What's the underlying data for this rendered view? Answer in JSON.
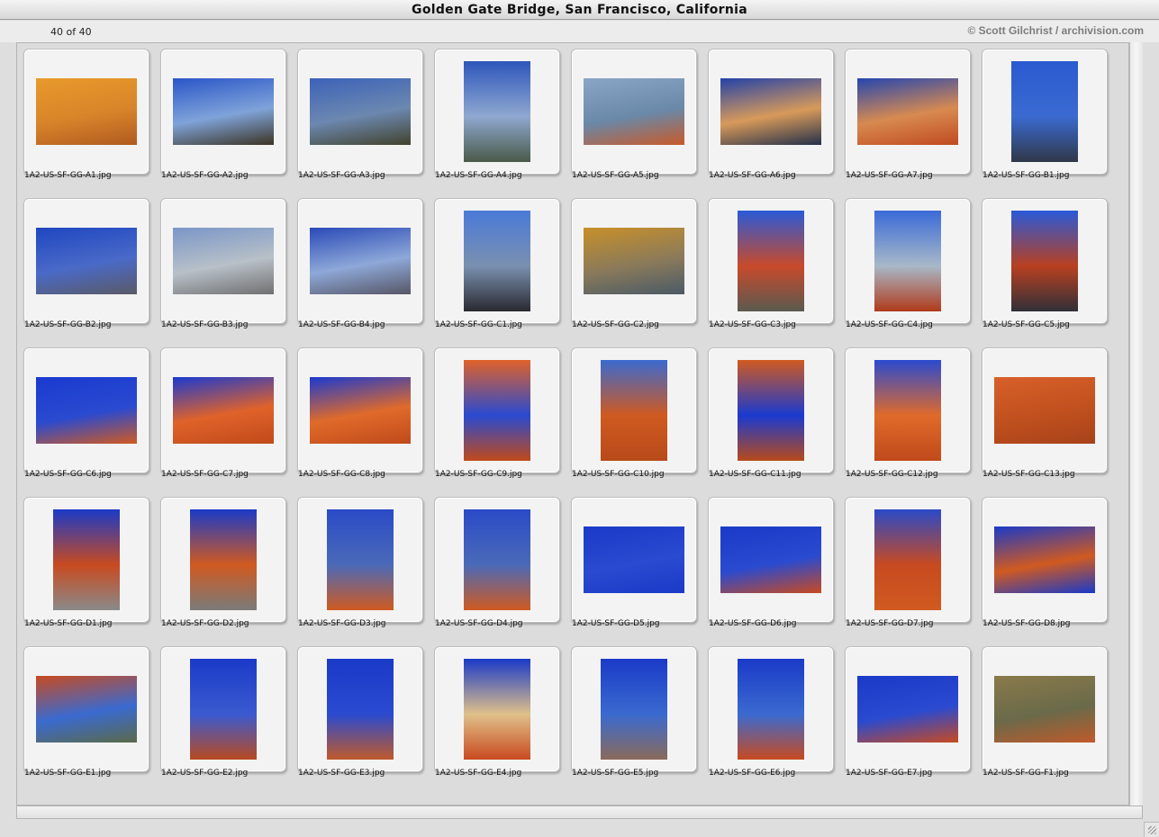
{
  "window": {
    "title": "Golden Gate Bridge, San Francisco, California"
  },
  "header": {
    "count": "40 of 40",
    "credit": "© Scott Gilchrist / archivision.com"
  },
  "rows": [
    {
      "items": [
        {
          "filename": "1A2-US-SF-GG-A1.jpg",
          "orientation": "h",
          "colors": [
            "#e89a2a",
            "#d8842a",
            "#b05a20"
          ]
        },
        {
          "filename": "1A2-US-SF-GG-A2.jpg",
          "orientation": "h",
          "colors": [
            "#2a56c8",
            "#7fa3d9",
            "#3c3424"
          ]
        },
        {
          "filename": "1A2-US-SF-GG-A3.jpg",
          "orientation": "h",
          "colors": [
            "#3c62b8",
            "#6c88b0",
            "#42422c"
          ]
        },
        {
          "filename": "1A2-US-SF-GG-A4.jpg",
          "orientation": "v",
          "colors": [
            "#2d56bb",
            "#8fa8d0",
            "#4a5a48"
          ]
        },
        {
          "filename": "1A2-US-SF-GG-A5.jpg",
          "orientation": "h",
          "colors": [
            "#8aa6c6",
            "#6a88a8",
            "#c85a2a"
          ]
        },
        {
          "filename": "1A2-US-SF-GG-A6.jpg",
          "orientation": "h",
          "colors": [
            "#2342a8",
            "#d89a5a",
            "#24304a"
          ]
        },
        {
          "filename": "1A2-US-SF-GG-A7.jpg",
          "orientation": "h",
          "colors": [
            "#2446b0",
            "#d88a50",
            "#c04a20"
          ]
        },
        {
          "filename": "1A2-US-SF-GG-B1.jpg",
          "orientation": "v",
          "colors": [
            "#2a5ad0",
            "#3a6ad0",
            "#303848"
          ]
        }
      ]
    },
    {
      "items": [
        {
          "filename": "1A2-US-SF-GG-B2.jpg",
          "orientation": "h",
          "colors": [
            "#1e46c0",
            "#4a6ac8",
            "#5a5a66"
          ]
        },
        {
          "filename": "1A2-US-SF-GG-B3.jpg",
          "orientation": "h",
          "colors": [
            "#7a96c8",
            "#b8c0c8",
            "#707070"
          ]
        },
        {
          "filename": "1A2-US-SF-GG-B4.jpg",
          "orientation": "h",
          "colors": [
            "#2a4ab8",
            "#8ea8d8",
            "#565666"
          ]
        },
        {
          "filename": "1A2-US-SF-GG-C1.jpg",
          "orientation": "v",
          "colors": [
            "#4a7ad8",
            "#7a90b0",
            "#2a2a30"
          ]
        },
        {
          "filename": "1A2-US-SF-GG-C2.jpg",
          "orientation": "h",
          "colors": [
            "#c8902a",
            "#8a7a5a",
            "#4a5a66"
          ]
        },
        {
          "filename": "1A2-US-SF-GG-C3.jpg",
          "orientation": "v",
          "colors": [
            "#2a5ad8",
            "#c84a2a",
            "#5a5a50"
          ]
        },
        {
          "filename": "1A2-US-SF-GG-C4.jpg",
          "orientation": "v",
          "colors": [
            "#3a6ad8",
            "#a8b8c8",
            "#b03a1a"
          ]
        },
        {
          "filename": "1A2-US-SF-GG-C5.jpg",
          "orientation": "v",
          "colors": [
            "#2a5ad8",
            "#b84020",
            "#303038"
          ]
        }
      ]
    },
    {
      "items": [
        {
          "filename": "1A2-US-SF-GG-C6.jpg",
          "orientation": "h",
          "colors": [
            "#1a3ad0",
            "#2a4ad0",
            "#d05a20"
          ]
        },
        {
          "filename": "1A2-US-SF-GG-C7.jpg",
          "orientation": "h",
          "colors": [
            "#1a3ad0",
            "#e0622a",
            "#c04a1a"
          ]
        },
        {
          "filename": "1A2-US-SF-GG-C8.jpg",
          "orientation": "h",
          "colors": [
            "#1a3ad0",
            "#e06a2a",
            "#c04a1a"
          ]
        },
        {
          "filename": "1A2-US-SF-GG-C9.jpg",
          "orientation": "v",
          "colors": [
            "#e0622a",
            "#2a4ad0",
            "#c04a1a"
          ]
        },
        {
          "filename": "1A2-US-SF-GG-C10.jpg",
          "orientation": "v",
          "colors": [
            "#3a6ad0",
            "#d05a20",
            "#b84a1a"
          ]
        },
        {
          "filename": "1A2-US-SF-GG-C11.jpg",
          "orientation": "v",
          "colors": [
            "#d05a20",
            "#1a3ad0",
            "#b84a1a"
          ]
        },
        {
          "filename": "1A2-US-SF-GG-C12.jpg",
          "orientation": "v",
          "colors": [
            "#2a4ad0",
            "#e06a2a",
            "#c04a1a"
          ]
        },
        {
          "filename": "1A2-US-SF-GG-C13.jpg",
          "orientation": "h",
          "colors": [
            "#d8602a",
            "#c0501e",
            "#a8421a"
          ]
        }
      ]
    },
    {
      "items": [
        {
          "filename": "1A2-US-SF-GG-D1.jpg",
          "orientation": "v",
          "colors": [
            "#1a3ac8",
            "#c84a20",
            "#8a8a8a"
          ]
        },
        {
          "filename": "1A2-US-SF-GG-D2.jpg",
          "orientation": "v",
          "colors": [
            "#1a3ac8",
            "#d05a20",
            "#7a7a7a"
          ]
        },
        {
          "filename": "1A2-US-SF-GG-D3.jpg",
          "orientation": "v",
          "colors": [
            "#2a4ac8",
            "#4a6ab8",
            "#d05a20"
          ]
        },
        {
          "filename": "1A2-US-SF-GG-D4.jpg",
          "orientation": "v",
          "colors": [
            "#2a4ac8",
            "#4a6ab8",
            "#d05a20"
          ]
        },
        {
          "filename": "1A2-US-SF-GG-D5.jpg",
          "orientation": "h",
          "colors": [
            "#1a3ac8",
            "#2a4ad0",
            "#1a3ac8"
          ]
        },
        {
          "filename": "1A2-US-SF-GG-D6.jpg",
          "orientation": "h",
          "colors": [
            "#1a3ac8",
            "#2a4ad0",
            "#c84a20"
          ]
        },
        {
          "filename": "1A2-US-SF-GG-D7.jpg",
          "orientation": "v",
          "colors": [
            "#2a4ac8",
            "#c84a20",
            "#d05a20"
          ]
        },
        {
          "filename": "1A2-US-SF-GG-D8.jpg",
          "orientation": "h",
          "colors": [
            "#1a3ac8",
            "#d05a20",
            "#1a3ac8"
          ]
        }
      ]
    },
    {
      "items": [
        {
          "filename": "1A2-US-SF-GG-E1.jpg",
          "orientation": "h",
          "colors": [
            "#c84a20",
            "#3a6ad0",
            "#5a6a4a"
          ]
        },
        {
          "filename": "1A2-US-SF-GG-E2.jpg",
          "orientation": "v",
          "colors": [
            "#1a3ac8",
            "#3a5ad0",
            "#b84a20"
          ]
        },
        {
          "filename": "1A2-US-SF-GG-E3.jpg",
          "orientation": "v",
          "colors": [
            "#1a3ac8",
            "#2a4ad0",
            "#c05a2a"
          ]
        },
        {
          "filename": "1A2-US-SF-GG-E4.jpg",
          "orientation": "v",
          "colors": [
            "#1a3ac8",
            "#e0c08a",
            "#c84a20"
          ]
        },
        {
          "filename": "1A2-US-SF-GG-E5.jpg",
          "orientation": "v",
          "colors": [
            "#1a3ac8",
            "#3a6ad0",
            "#8a6a5a"
          ]
        },
        {
          "filename": "1A2-US-SF-GG-E6.jpg",
          "orientation": "v",
          "colors": [
            "#1a3ac8",
            "#3a6ad0",
            "#c84a20"
          ]
        },
        {
          "filename": "1A2-US-SF-GG-E7.jpg",
          "orientation": "h",
          "colors": [
            "#1a3ac8",
            "#2a4ad0",
            "#c84a20"
          ]
        },
        {
          "filename": "1A2-US-SF-GG-F1.jpg",
          "orientation": "h",
          "colors": [
            "#8a7a4a",
            "#6a6a4a",
            "#c05a2a"
          ]
        }
      ]
    }
  ]
}
